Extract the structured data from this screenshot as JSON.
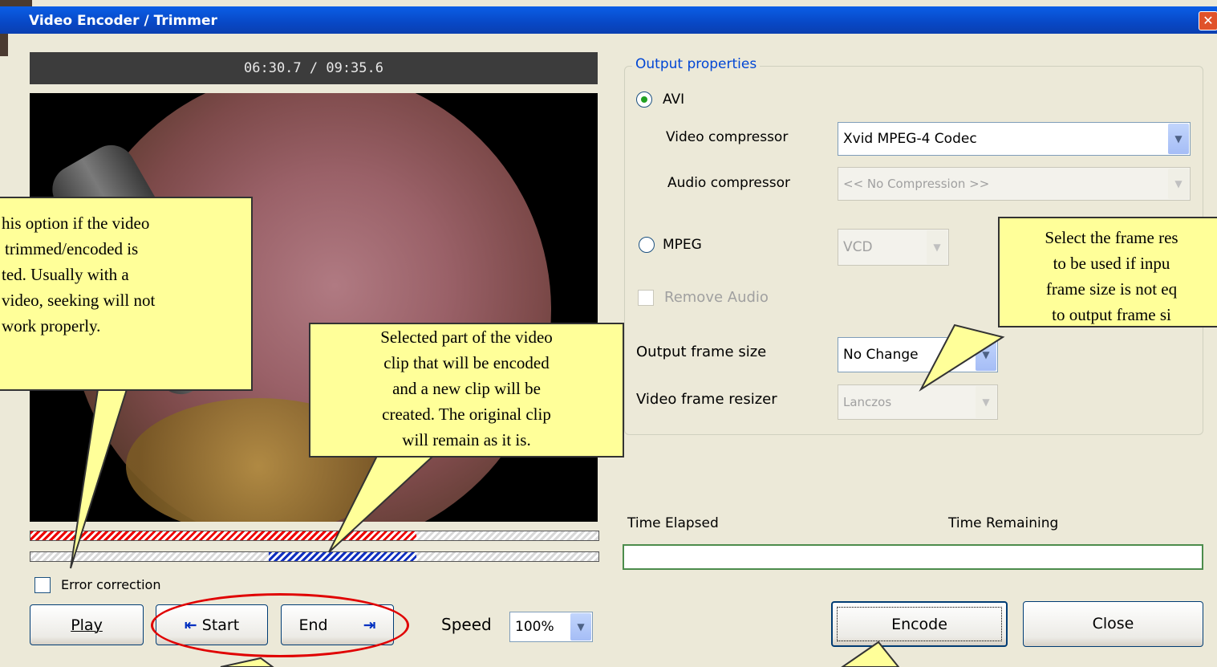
{
  "window": {
    "title": "Video Encoder / Trimmer",
    "close_glyph": "✕"
  },
  "player": {
    "time": "06:30.7 / 09:35.6",
    "error_correction_label": "Error correction",
    "error_correction_checked": false,
    "play_label": "Play",
    "start_label": "Start",
    "end_label": "End",
    "start_icon": "arrow-left-to-bar-icon",
    "end_icon": "arrow-right-to-bar-icon",
    "speed_label": "Speed",
    "speed_value": "100%",
    "played_fraction": 0.68,
    "selection_start_fraction": 0.42,
    "selection_end_fraction": 0.68
  },
  "output": {
    "group_label": "Output properties",
    "avi_label": "AVI",
    "avi_selected": true,
    "video_compressor_label": "Video compressor",
    "video_compressor_value": "Xvid MPEG-4 Codec",
    "audio_compressor_label": "Audio compressor",
    "audio_compressor_value": "<< No Compression >>",
    "mpeg_label": "MPEG",
    "mpeg_selected": false,
    "mpeg_value": "VCD",
    "remove_audio_label": "Remove Audio",
    "output_frame_size_label": "Output frame size",
    "output_frame_size_value": "No Change",
    "video_frame_resizer_label": "Video frame resizer",
    "video_frame_resizer_value": "Lanczos"
  },
  "progress": {
    "time_elapsed_label": "Time Elapsed",
    "time_remaining_label": "Time Remaining",
    "percent": 0
  },
  "actions": {
    "encode_label": "Encode",
    "close_label": "Close"
  },
  "callouts": {
    "error_correction": [
      "his option if the video",
      "trimmed/encoded is",
      "ted. Usually with a",
      "video, seeking will not",
      "work properly."
    ],
    "selection": [
      "Selected part of the video",
      "clip that will be encoded",
      "and a new clip will be",
      "created. The original clip",
      "will remain as it is."
    ],
    "frame_resizer": [
      "Select the frame res",
      "to be used if inpu",
      "frame size is not eq",
      "to output frame si"
    ]
  },
  "colors": {
    "titlebar": "#0a50d8",
    "callout_fill": "#ffff99",
    "selection_red": "#e00000",
    "selection_blue": "#1030c0",
    "group_label": "#0046d5"
  }
}
